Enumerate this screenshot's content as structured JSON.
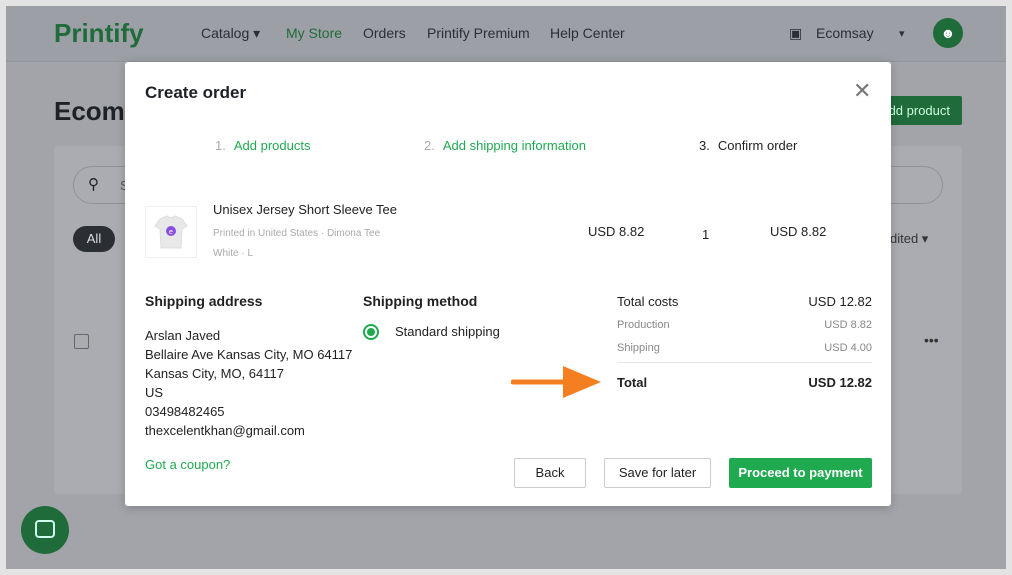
{
  "header": {
    "logo": "Printify",
    "nav": [
      "Catalog ▾",
      "My Store",
      "Orders",
      "Printify Premium",
      "Help Center"
    ],
    "store": "Ecomsay",
    "store_caret": "▾"
  },
  "background": {
    "title": "Ecoms",
    "add_product": "dd product",
    "all_filter": "All",
    "sort_label": "dited ▾",
    "search_placeholder": "S"
  },
  "modal": {
    "title": "Create order",
    "steps": [
      {
        "num": "1.",
        "label": "Add products"
      },
      {
        "num": "2.",
        "label": "Add shipping information"
      },
      {
        "num": "3.",
        "label": "Confirm order"
      }
    ],
    "product": {
      "name": "Unisex Jersey Short Sleeve Tee",
      "meta": "Printed in United States · Dimona Tee",
      "variant": "White · L",
      "price": "USD 8.82",
      "qty": "1",
      "total": "USD 8.82"
    },
    "shipping_address": {
      "heading": "Shipping address",
      "lines": [
        "Arslan Javed",
        "Bellaire Ave Kansas City, MO 64117",
        "Kansas City, MO, 64117",
        "US",
        "03498482465",
        "thexcelentkhan@gmail.com"
      ]
    },
    "shipping_method": {
      "heading": "Shipping method",
      "option": "Standard shipping"
    },
    "costs": {
      "total_costs_label": "Total costs",
      "total_costs": "USD 12.82",
      "production_label": "Production",
      "production": "USD 8.82",
      "shipping_label": "Shipping",
      "shipping": "USD 4.00",
      "total_label": "Total",
      "total": "USD 12.82"
    },
    "coupon": "Got a coupon?",
    "buttons": {
      "back": "Back",
      "save": "Save for later",
      "proceed": "Proceed to payment"
    }
  },
  "colors": {
    "accent": "#1faa50",
    "arrow": "#f47f20"
  }
}
